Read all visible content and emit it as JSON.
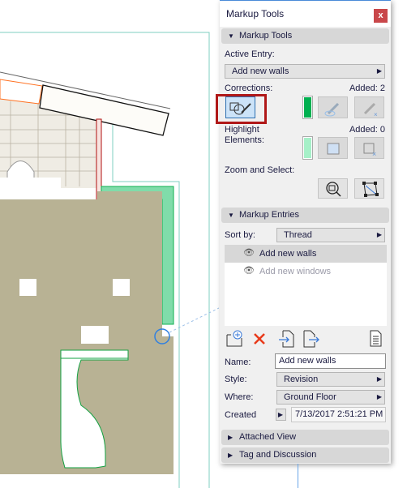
{
  "panel": {
    "title": "Markup Tools",
    "close_label": "x",
    "markup_tools": {
      "header": "Markup Tools",
      "active_entry_label": "Active Entry:",
      "active_entry_value": "Add new walls",
      "corrections_label": "Corrections:",
      "corrections_added": "Added: 2",
      "corrections_color": "#00b050",
      "highlight_label_1": "Highlight",
      "highlight_label_2": "Elements:",
      "highlight_added": "Added: 0",
      "highlight_color": "#a6f0c8",
      "zoom_select_label": "Zoom and Select:"
    },
    "markup_entries": {
      "header": "Markup Entries",
      "sort_label": "Sort by:",
      "sort_value": "Thread",
      "entries": [
        {
          "label": "Add new walls",
          "selected": true
        },
        {
          "label": "Add new windows",
          "selected": false
        }
      ],
      "name_label": "Name:",
      "name_value": "Add new walls",
      "style_label": "Style:",
      "style_value": "Revision",
      "where_label": "Where:",
      "where_value": "Ground Floor",
      "created_label": "Created",
      "created_value": "7/13/2017 2:51:21 PM"
    },
    "attached_view_header": "Attached View",
    "tag_discussion_header": "Tag and Discussion"
  }
}
